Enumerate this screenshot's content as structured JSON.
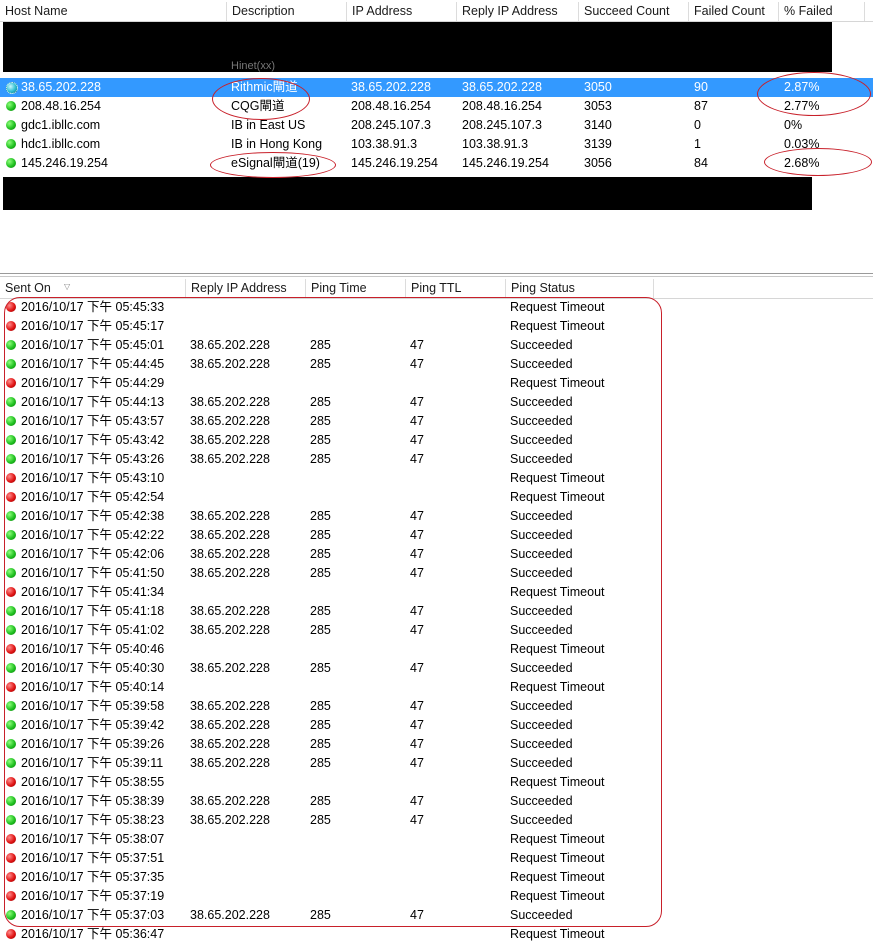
{
  "hosts_table": {
    "columns": [
      "Host Name",
      "Description",
      "IP Address",
      "Reply IP Address",
      "Succeed Count",
      "Failed Count",
      "% Failed"
    ],
    "partial_row_text": "Hinet(xx)",
    "rows": [
      {
        "host": "38.65.202.228",
        "description": "Rithmic閘道",
        "ip": "38.65.202.228",
        "reply_ip": "38.65.202.228",
        "succeed": "3050",
        "failed": "90",
        "pct_failed": "2.87%",
        "status": "selected"
      },
      {
        "host": "208.48.16.254",
        "description": "CQG閘道",
        "ip": "208.48.16.254",
        "reply_ip": "208.48.16.254",
        "succeed": "3053",
        "failed": "87",
        "pct_failed": "2.77%",
        "status": "green"
      },
      {
        "host": "gdc1.ibllc.com",
        "description": "IB in East US",
        "ip": "208.245.107.3",
        "reply_ip": "208.245.107.3",
        "succeed": "3140",
        "failed": "0",
        "pct_failed": "0%",
        "status": "green"
      },
      {
        "host": "hdc1.ibllc.com",
        "description": "IB in Hong Kong",
        "ip": "103.38.91.3",
        "reply_ip": "103.38.91.3",
        "succeed": "3139",
        "failed": "1",
        "pct_failed": "0.03%",
        "status": "green"
      },
      {
        "host": "145.246.19.254",
        "description": "eSignal閘道(19)",
        "ip": "145.246.19.254",
        "reply_ip": "145.246.19.254",
        "succeed": "3056",
        "failed": "84",
        "pct_failed": "2.68%",
        "status": "green"
      }
    ]
  },
  "log_table": {
    "columns": [
      "Sent On",
      "Reply IP Address",
      "Ping Time",
      "Ping TTL",
      "Ping Status"
    ],
    "rows": [
      {
        "sent": "2016/10/17 下午 05:45:33",
        "reply_ip": "",
        "time": "",
        "ttl": "",
        "status": "Request Timeout",
        "ok": false
      },
      {
        "sent": "2016/10/17 下午 05:45:17",
        "reply_ip": "",
        "time": "",
        "ttl": "",
        "status": "Request Timeout",
        "ok": false
      },
      {
        "sent": "2016/10/17 下午 05:45:01",
        "reply_ip": "38.65.202.228",
        "time": "285",
        "ttl": "47",
        "status": "Succeeded",
        "ok": true
      },
      {
        "sent": "2016/10/17 下午 05:44:45",
        "reply_ip": "38.65.202.228",
        "time": "285",
        "ttl": "47",
        "status": "Succeeded",
        "ok": true
      },
      {
        "sent": "2016/10/17 下午 05:44:29",
        "reply_ip": "",
        "time": "",
        "ttl": "",
        "status": "Request Timeout",
        "ok": false
      },
      {
        "sent": "2016/10/17 下午 05:44:13",
        "reply_ip": "38.65.202.228",
        "time": "285",
        "ttl": "47",
        "status": "Succeeded",
        "ok": true
      },
      {
        "sent": "2016/10/17 下午 05:43:57",
        "reply_ip": "38.65.202.228",
        "time": "285",
        "ttl": "47",
        "status": "Succeeded",
        "ok": true
      },
      {
        "sent": "2016/10/17 下午 05:43:42",
        "reply_ip": "38.65.202.228",
        "time": "285",
        "ttl": "47",
        "status": "Succeeded",
        "ok": true
      },
      {
        "sent": "2016/10/17 下午 05:43:26",
        "reply_ip": "38.65.202.228",
        "time": "285",
        "ttl": "47",
        "status": "Succeeded",
        "ok": true
      },
      {
        "sent": "2016/10/17 下午 05:43:10",
        "reply_ip": "",
        "time": "",
        "ttl": "",
        "status": "Request Timeout",
        "ok": false
      },
      {
        "sent": "2016/10/17 下午 05:42:54",
        "reply_ip": "",
        "time": "",
        "ttl": "",
        "status": "Request Timeout",
        "ok": false
      },
      {
        "sent": "2016/10/17 下午 05:42:38",
        "reply_ip": "38.65.202.228",
        "time": "285",
        "ttl": "47",
        "status": "Succeeded",
        "ok": true
      },
      {
        "sent": "2016/10/17 下午 05:42:22",
        "reply_ip": "38.65.202.228",
        "time": "285",
        "ttl": "47",
        "status": "Succeeded",
        "ok": true
      },
      {
        "sent": "2016/10/17 下午 05:42:06",
        "reply_ip": "38.65.202.228",
        "time": "285",
        "ttl": "47",
        "status": "Succeeded",
        "ok": true
      },
      {
        "sent": "2016/10/17 下午 05:41:50",
        "reply_ip": "38.65.202.228",
        "time": "285",
        "ttl": "47",
        "status": "Succeeded",
        "ok": true
      },
      {
        "sent": "2016/10/17 下午 05:41:34",
        "reply_ip": "",
        "time": "",
        "ttl": "",
        "status": "Request Timeout",
        "ok": false
      },
      {
        "sent": "2016/10/17 下午 05:41:18",
        "reply_ip": "38.65.202.228",
        "time": "285",
        "ttl": "47",
        "status": "Succeeded",
        "ok": true
      },
      {
        "sent": "2016/10/17 下午 05:41:02",
        "reply_ip": "38.65.202.228",
        "time": "285",
        "ttl": "47",
        "status": "Succeeded",
        "ok": true
      },
      {
        "sent": "2016/10/17 下午 05:40:46",
        "reply_ip": "",
        "time": "",
        "ttl": "",
        "status": "Request Timeout",
        "ok": false
      },
      {
        "sent": "2016/10/17 下午 05:40:30",
        "reply_ip": "38.65.202.228",
        "time": "285",
        "ttl": "47",
        "status": "Succeeded",
        "ok": true
      },
      {
        "sent": "2016/10/17 下午 05:40:14",
        "reply_ip": "",
        "time": "",
        "ttl": "",
        "status": "Request Timeout",
        "ok": false
      },
      {
        "sent": "2016/10/17 下午 05:39:58",
        "reply_ip": "38.65.202.228",
        "time": "285",
        "ttl": "47",
        "status": "Succeeded",
        "ok": true
      },
      {
        "sent": "2016/10/17 下午 05:39:42",
        "reply_ip": "38.65.202.228",
        "time": "285",
        "ttl": "47",
        "status": "Succeeded",
        "ok": true
      },
      {
        "sent": "2016/10/17 下午 05:39:26",
        "reply_ip": "38.65.202.228",
        "time": "285",
        "ttl": "47",
        "status": "Succeeded",
        "ok": true
      },
      {
        "sent": "2016/10/17 下午 05:39:11",
        "reply_ip": "38.65.202.228",
        "time": "285",
        "ttl": "47",
        "status": "Succeeded",
        "ok": true
      },
      {
        "sent": "2016/10/17 下午 05:38:55",
        "reply_ip": "",
        "time": "",
        "ttl": "",
        "status": "Request Timeout",
        "ok": false
      },
      {
        "sent": "2016/10/17 下午 05:38:39",
        "reply_ip": "38.65.202.228",
        "time": "285",
        "ttl": "47",
        "status": "Succeeded",
        "ok": true
      },
      {
        "sent": "2016/10/17 下午 05:38:23",
        "reply_ip": "38.65.202.228",
        "time": "285",
        "ttl": "47",
        "status": "Succeeded",
        "ok": true
      },
      {
        "sent": "2016/10/17 下午 05:38:07",
        "reply_ip": "",
        "time": "",
        "ttl": "",
        "status": "Request Timeout",
        "ok": false
      },
      {
        "sent": "2016/10/17 下午 05:37:51",
        "reply_ip": "",
        "time": "",
        "ttl": "",
        "status": "Request Timeout",
        "ok": false
      },
      {
        "sent": "2016/10/17 下午 05:37:35",
        "reply_ip": "",
        "time": "",
        "ttl": "",
        "status": "Request Timeout",
        "ok": false
      },
      {
        "sent": "2016/10/17 下午 05:37:19",
        "reply_ip": "",
        "time": "",
        "ttl": "",
        "status": "Request Timeout",
        "ok": false
      },
      {
        "sent": "2016/10/17 下午 05:37:03",
        "reply_ip": "38.65.202.228",
        "time": "285",
        "ttl": "47",
        "status": "Succeeded",
        "ok": true
      },
      {
        "sent": "2016/10/17 下午 05:36:47",
        "reply_ip": "",
        "time": "",
        "ttl": "",
        "status": "Request Timeout",
        "ok": false
      }
    ]
  },
  "colors": {
    "selection": "#3399ff",
    "annotation": "#c8202a",
    "status_ok": "#20c020",
    "status_fail": "#e01414"
  }
}
